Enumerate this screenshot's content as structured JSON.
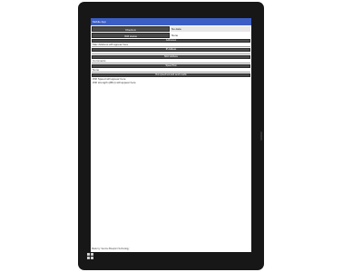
{
  "app": {
    "title": "Mobile App"
  },
  "checkin": {
    "button_label": "Check-in",
    "value": "No data"
  },
  "wifi": {
    "button_label": "Wifi status",
    "value": "None"
  },
  "section_headers": {
    "addresses": "Addresses",
    "ip_address": "IP Address",
    "mac": "MAC Address",
    "speed": "Speed Test"
  },
  "address_text": "Mac Address will appear here",
  "comments_text": "Comments",
  "none_text": "None",
  "send_bar": "Run speed test and send results",
  "speed_text": "Wifi Speed will appear here",
  "strength_text": "Wifi strength (dBm) will appear here",
  "footer_text": "Made by: Service Blueprint Technology",
  "icons": {
    "windows": "windows-logo-icon"
  }
}
